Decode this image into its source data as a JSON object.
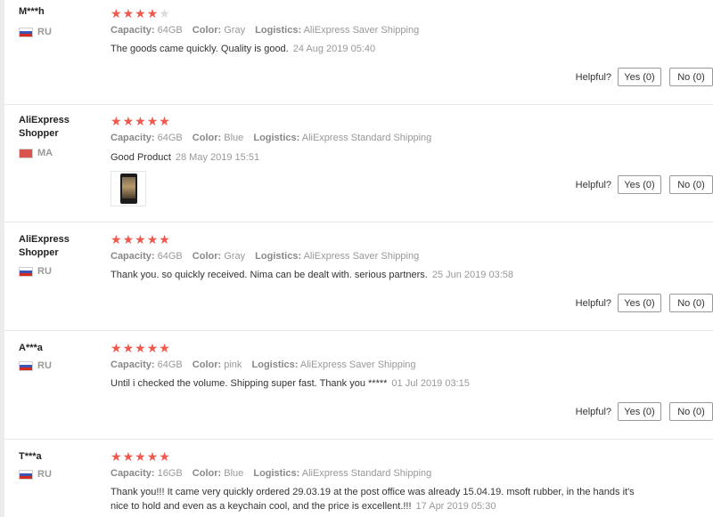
{
  "helpful_label": "Helpful?",
  "reviews": [
    {
      "user": "M***h",
      "country": "RU",
      "flag": "ru",
      "rating": 4,
      "capacity_label": "Capacity:",
      "capacity": "64GB",
      "color_label": "Color:",
      "color": "Gray",
      "logistics_label": "Logistics:",
      "logistics": "AliExpress Saver Shipping",
      "text": "The goods came quickly. Quality is good.",
      "date": "24 Aug 2019 05:40",
      "yes": "Yes (0)",
      "no": "No (0)"
    },
    {
      "user": "AliExpress Shopper",
      "country": "MA",
      "flag": "ma",
      "rating": 5,
      "capacity_label": "Capacity:",
      "capacity": "64GB",
      "color_label": "Color:",
      "color": "Blue",
      "logistics_label": "Logistics:",
      "logistics": "AliExpress Standard Shipping",
      "text": "Good Product",
      "date": "28 May 2019 15:51",
      "has_photo": true,
      "yes": "Yes (0)",
      "no": "No (0)"
    },
    {
      "user": "AliExpress Shopper",
      "country": "RU",
      "flag": "ru",
      "rating": 5,
      "capacity_label": "Capacity:",
      "capacity": "64GB",
      "color_label": "Color:",
      "color": "Gray",
      "logistics_label": "Logistics:",
      "logistics": "AliExpress Saver Shipping",
      "text": "Thank you. so quickly received. Nima can be dealt with. serious partners.",
      "date": "25 Jun 2019 03:58",
      "yes": "Yes (0)",
      "no": "No (0)"
    },
    {
      "user": "A***a",
      "country": "RU",
      "flag": "ru",
      "rating": 5,
      "capacity_label": "Capacity:",
      "capacity": "64GB",
      "color_label": "Color:",
      "color": "pink",
      "logistics_label": "Logistics:",
      "logistics": "AliExpress Saver Shipping",
      "text": "Until i checked the volume. Shipping super fast. Thank you *****",
      "date": "01 Jul 2019 03:15",
      "yes": "Yes (0)",
      "no": "No (0)"
    },
    {
      "user": "T***a",
      "country": "RU",
      "flag": "ru",
      "rating": 5,
      "capacity_label": "Capacity:",
      "capacity": "16GB",
      "color_label": "Color:",
      "color": "Blue",
      "logistics_label": "Logistics:",
      "logistics": "AliExpress Standard Shipping",
      "text": "Thank you!!! It came very quickly ordered 29.03.19 at the post office was already 15.04.19. msoft rubber, in the hands it's nice to hold and even as a keychain cool, and the price is excellent.!!!",
      "date": "17 Apr 2019 05:30"
    }
  ]
}
